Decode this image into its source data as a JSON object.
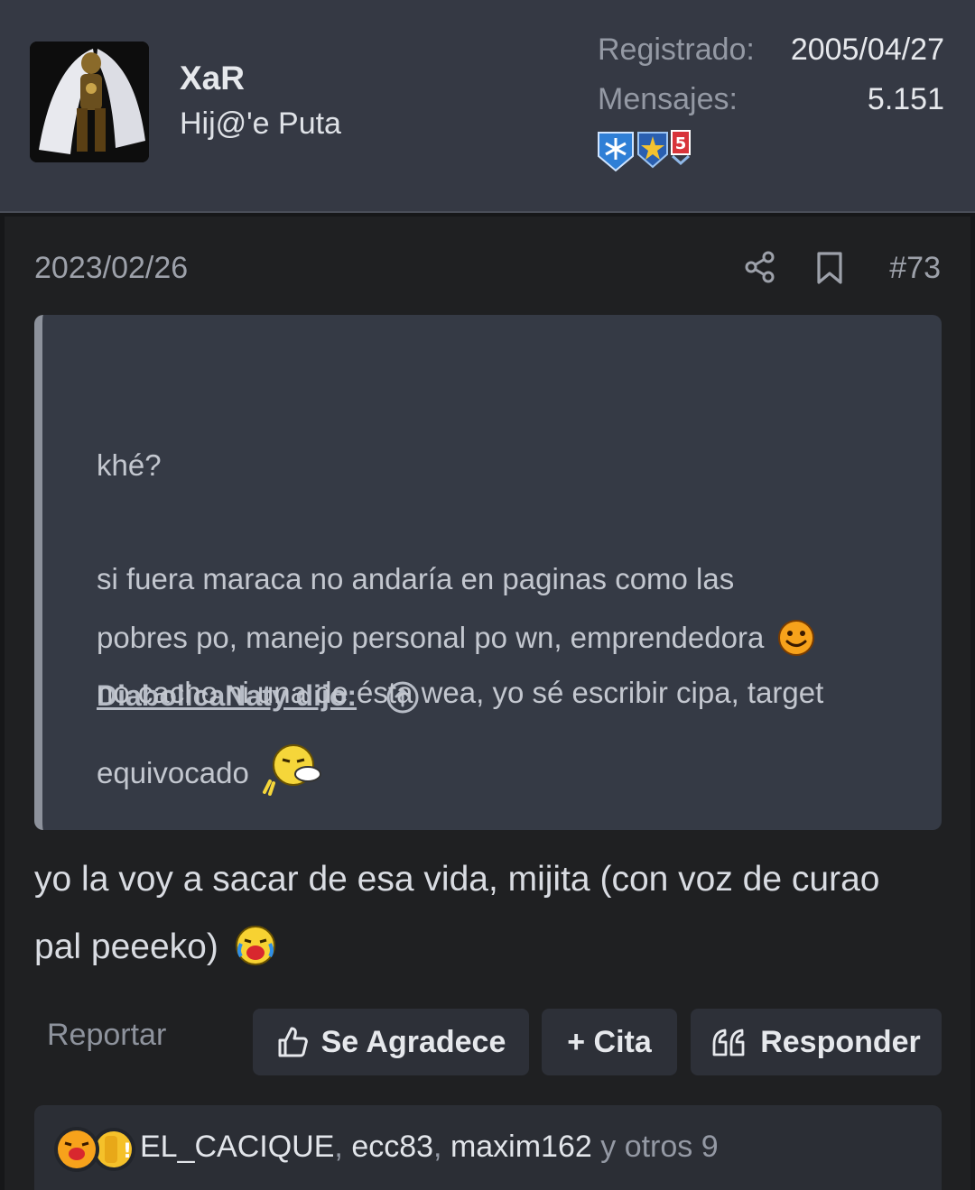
{
  "user": {
    "name": "XaR",
    "title": "Hij@'e Puta",
    "registered_label": "Registrado:",
    "registered_value": "2005/04/27",
    "messages_label": "Mensajes:",
    "messages_value": "5.151"
  },
  "post": {
    "date": "2023/02/26",
    "number": "#73",
    "quote": {
      "author": "DiabolicaNaty dijo:",
      "lines": [
        "khé?",
        "si fuera maraca no andaría en paginas como las",
        "pobres po, manejo personal po wn, emprendedora",
        "no cacho ni una de ésta wea, yo sé escribir cipa, target",
        "equivocado"
      ]
    },
    "reply_lines": [
      "yo la voy a sacar de esa vida, mijita (con voz de curao",
      "pal peeeko)"
    ]
  },
  "actions": {
    "report": "Reportar",
    "thank": "Se Agradece",
    "quote": "+ Cita",
    "reply": "Responder"
  },
  "reactions": {
    "user1": "EL_CACIQUE",
    "sep1": ", ",
    "user2": "ecc83",
    "sep2": ", ",
    "user3": "maxim162",
    "others": " y otros 9"
  },
  "icons": [
    "share-icon",
    "bookmark-icon",
    "arrow-up-circle-icon",
    "thumbs-up-icon",
    "quote-marks-icon"
  ]
}
